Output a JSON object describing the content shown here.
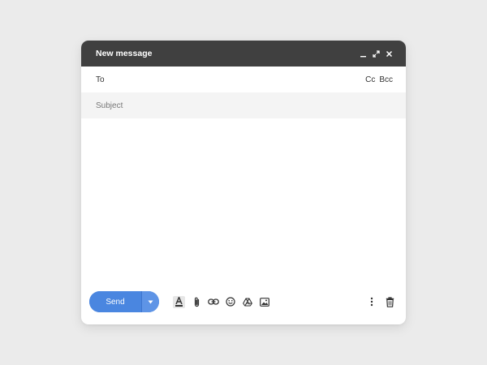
{
  "window": {
    "title": "New message",
    "controls": [
      "minimize-icon",
      "expand-icon",
      "close-icon"
    ]
  },
  "recipients": {
    "to_label": "To",
    "cc_label": "Cc",
    "bcc_label": "Bcc"
  },
  "subject": {
    "placeholder": "Subject",
    "value": ""
  },
  "body": {
    "value": ""
  },
  "toolbar": {
    "send_label": "Send",
    "send_options_icon": "caret-down-icon",
    "tools": [
      "text-format-icon",
      "attach-icon",
      "link-icon",
      "emoji-icon",
      "drive-icon",
      "image-icon"
    ],
    "right_tools": [
      "more-options-icon",
      "trash-icon"
    ]
  },
  "colors": {
    "titlebar": "#404040",
    "send_button": "#4a86e0",
    "background": "#ebebeb",
    "subject_row": "#f4f4f4"
  }
}
